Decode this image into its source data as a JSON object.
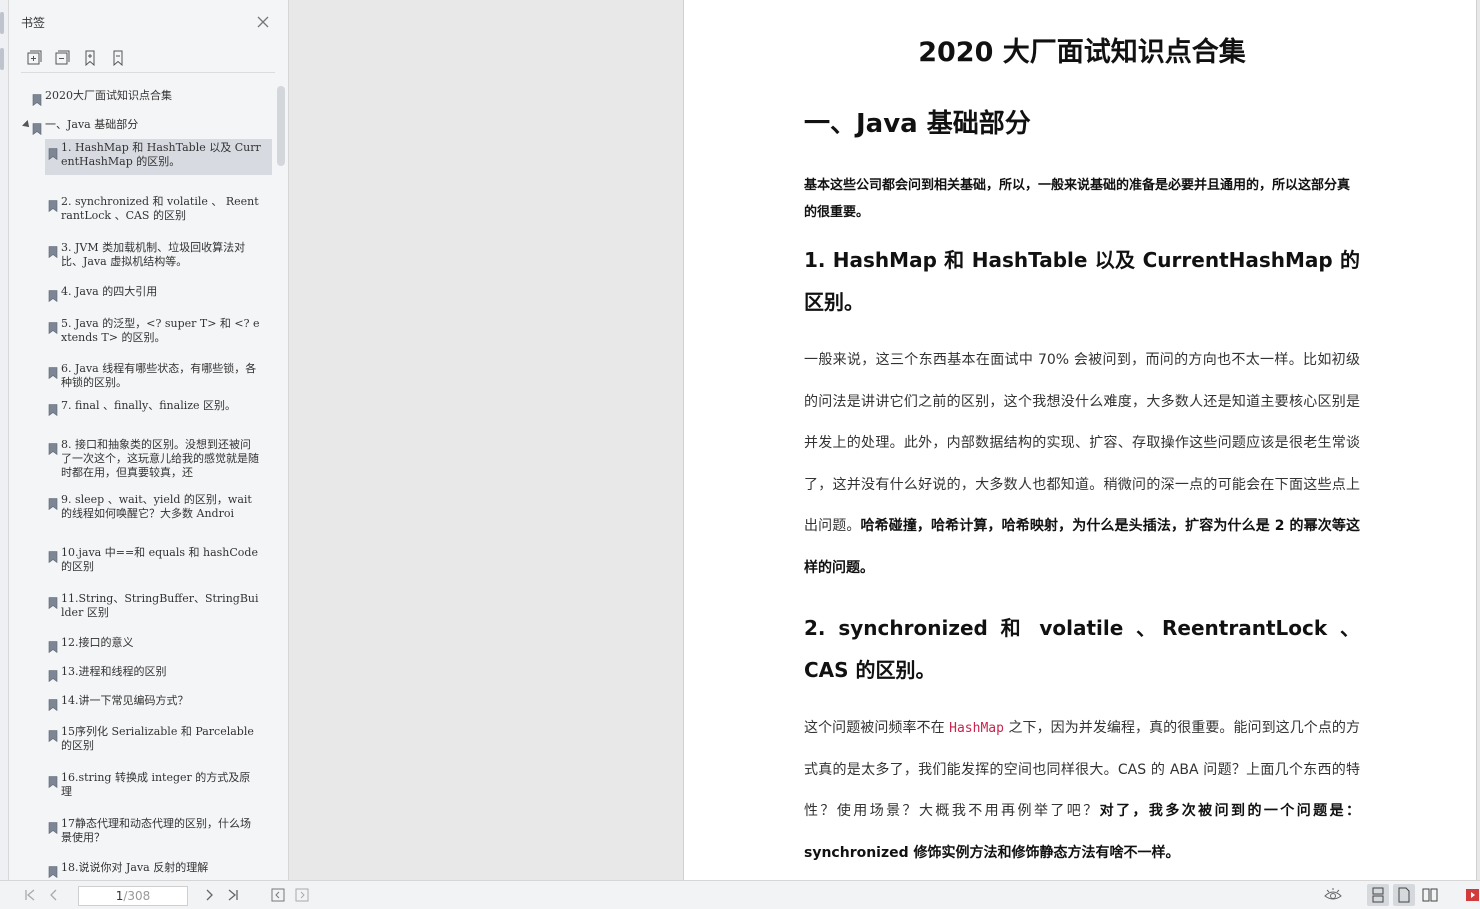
{
  "sidebar": {
    "title": "书签",
    "tools": [
      "expand-all-icon",
      "collapse-all-icon",
      "add-bookmark-icon",
      "bookmark-icon"
    ],
    "items": [
      {
        "label": "2020大厂面试知识点合集",
        "level": 0
      },
      {
        "label": "一、Java 基础部分",
        "level": 0,
        "expanded": true
      },
      {
        "label": "1. HashMap  和  HashTable  以及 CurrentHashMap  的区别。",
        "level": 1,
        "selected": true
      },
      {
        "label": "2. synchronized  和  volatile  、 ReentrantLock  、CAS 的区别",
        "level": 1
      },
      {
        "label": "3. JVM 类加载机制、垃圾回收算法对比、Java 虚拟机结构等。",
        "level": 1
      },
      {
        "label": "4. Java 的四大引用",
        "level": 1
      },
      {
        "label": "5. Java 的泛型，<? super T> 和 <? extends T> 的区别。",
        "level": 1
      },
      {
        "label": "6. Java 线程有哪些状态，有哪些锁，各种锁的区别。",
        "level": 1
      },
      {
        "label": "7. final  、finally、finalize  区别。",
        "level": 1
      },
      {
        "label": "8. 接口和抽象类的区别。没想到还被问了一次这个，这玩意儿给我的感觉就是随时都在用，但真要较真，还",
        "level": 1
      },
      {
        "label": "9. sleep  、wait、yield  的区别，wait  的线程如何唤醒它？大多数 Androi",
        "level": 1
      },
      {
        "label": "10.java 中==和 equals 和 hashCode 的区别",
        "level": 1
      },
      {
        "label": "11.String、StringBuffer、StringBuilder 区别",
        "level": 1
      },
      {
        "label": "12.接口的意义",
        "level": 1
      },
      {
        "label": "13.进程和线程的区别",
        "level": 1
      },
      {
        "label": "14.讲一下常见编码方式？",
        "level": 1
      },
      {
        "label": "15序列化 Serializable 和 Parcelable 的区别",
        "level": 1
      },
      {
        "label": "16.string 转换成 integer 的方式及原理",
        "level": 1
      },
      {
        "label": "17静态代理和动态代理的区别，什么场景使用？",
        "level": 1
      },
      {
        "label": "18.说说你对 Java 反射的理解",
        "level": 1
      }
    ]
  },
  "document": {
    "title": "2020 大厂面试知识点合集",
    "h1": "一、Java  基础部分",
    "intro": "基本这些公司都会问到相关基础，所以，一般来说基础的准备是必要并且通用的，所以这部分真的很重要。",
    "s1_heading": "1. HashMap  和  HashTable  以及  CurrentHashMap  的区别。",
    "s1_p_plain": "一般来说，这三个东西基本在面试中  70%  会被问到，而问的方向也不太一样。比如初级的问法是讲讲它们之前的区别，这个我想没什么难度，大多数人还是知道主要核心区别是并发上的处理。此外，内部数据结构的实现、扩容、存取操作这些问题应该是很老生常谈了，这并没有什么好说的，大多数人也都知道。稍微问的深一点的可能会在下面这些点上出问题。",
    "s1_p_bold": "哈希碰撞，哈希计算，哈希映射，为什么是头插法，扩容为什么是  2  的幂次等这样的问题。",
    "s2_heading": "2. synchronized  和  volatile  、ReentrantLock  、CAS  的区别。",
    "s2_p_a": "这个问题被问频率不在 ",
    "s2_p_code": "HashMap",
    "s2_p_b": " 之下，因为并发编程，真的很重要。能问到这几个点的方式真的是太多了，我们能发挥的空间也同样很大。CAS  的  ABA  问题？上面几个东西的特性？使用场景？大概我不用再例举了吧？",
    "s2_p_bold": "对了，我多次被问到的一个问题是：synchronized  修饰实例方法和修饰静态方法有啥不一样。"
  },
  "bottombar": {
    "current_page": "1",
    "total_pages": "/308",
    "icons": [
      "first-page-icon",
      "prev-page-icon",
      "next-page-icon",
      "last-page-icon",
      "prev-view-icon",
      "next-view-icon",
      "eye-protect-icon",
      "continuous-view-icon",
      "single-page-icon",
      "two-page-icon",
      "presentation-icon"
    ]
  }
}
